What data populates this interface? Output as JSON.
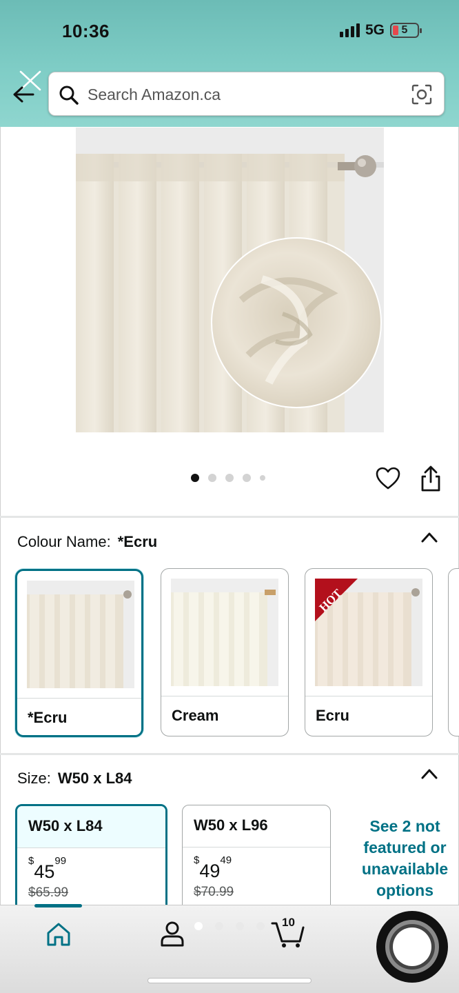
{
  "status_bar": {
    "time": "10:36",
    "network": "5G",
    "battery": "5"
  },
  "search": {
    "placeholder": "Search Amazon.ca"
  },
  "product": {
    "image_dots": 5,
    "active_dot": 0
  },
  "colour": {
    "title": "Colour Name:",
    "selected": "*Ecru",
    "options": [
      {
        "label": "*Ecru",
        "selected": true
      },
      {
        "label": "Cream",
        "selected": false
      },
      {
        "label": "Ecru",
        "selected": false,
        "badge": "HOT"
      }
    ]
  },
  "size": {
    "title": "Size:",
    "selected": "W50 x L84",
    "options": [
      {
        "label": "W50 x L84",
        "currency": "$",
        "price_whole": "45",
        "price_frac": "99",
        "was": "$65.99",
        "selected": true
      },
      {
        "label": "W50 x L96",
        "currency": "$",
        "price_whole": "49",
        "price_frac": "49",
        "was": "$70.99",
        "selected": false
      }
    ],
    "more_options": "See 2 not featured or unavailable options"
  },
  "nav": {
    "cart_count": "10"
  },
  "colors": {
    "accent": "#007185",
    "header": "#7fcdc6",
    "hot_badge": "#b3101c"
  }
}
